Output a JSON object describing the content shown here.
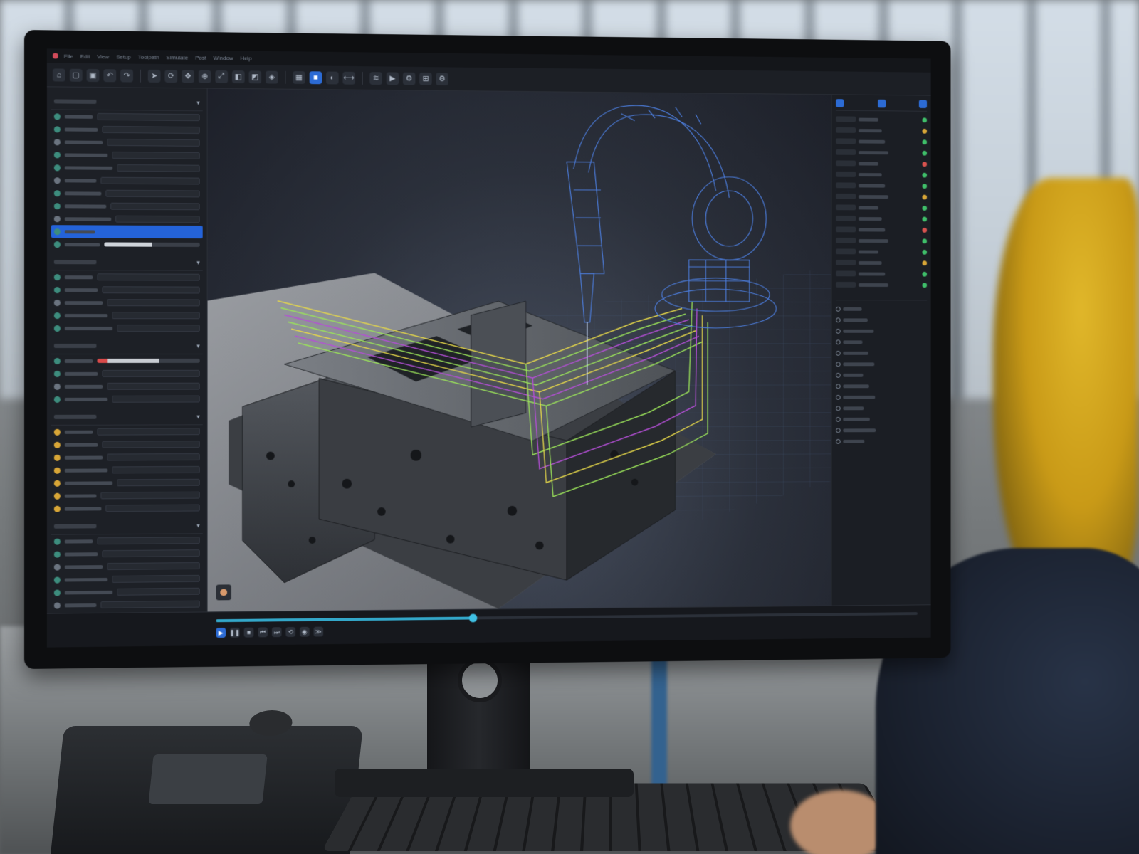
{
  "app": {
    "menu": [
      "File",
      "Edit",
      "View",
      "Setup",
      "Toolpath",
      "Simulate",
      "Post",
      "Window",
      "Help"
    ]
  },
  "toolbar": {
    "icons": [
      "home-icon",
      "open-icon",
      "save-icon",
      "undo-icon",
      "redo-icon",
      "select-icon",
      "rotate-icon",
      "pan-icon",
      "zoom-icon",
      "fit-icon",
      "view-front-icon",
      "view-top-icon",
      "view-iso-icon",
      "wireframe-icon",
      "shaded-icon",
      "section-icon",
      "measure-icon",
      "toolpath-icon",
      "simulate-icon",
      "robot-icon",
      "fixture-icon",
      "settings-icon"
    ]
  },
  "left_panel": {
    "sections": [
      {
        "id": "setup",
        "rows": 11,
        "selected_row": 9
      },
      {
        "id": "tool",
        "rows": 5
      },
      {
        "id": "strategy",
        "rows": 4
      },
      {
        "id": "operations",
        "rows": 7
      },
      {
        "id": "parameters",
        "rows": 6
      }
    ]
  },
  "right_panel": {
    "top_rows": 16,
    "bottom_rows": 13,
    "dot_colors": [
      "#3fbf6a",
      "#d8a637",
      "#3fbf6a",
      "#3fbf6a",
      "#d9534f",
      "#3fbf6a",
      "#3fbf6a",
      "#d8a637",
      "#3fbf6a",
      "#3fbf6a",
      "#d9534f",
      "#3fbf6a",
      "#3fbf6a",
      "#d8a637",
      "#3fbf6a",
      "#3fbf6a"
    ]
  },
  "timeline": {
    "progress": 0.36
  },
  "colors": {
    "accent": "#2463d9",
    "wireframe": "#4d7fe0",
    "toolpath_green": "#9be35a",
    "toolpath_purple": "#b44fd6",
    "toolpath_yellow": "#e6d84a"
  }
}
